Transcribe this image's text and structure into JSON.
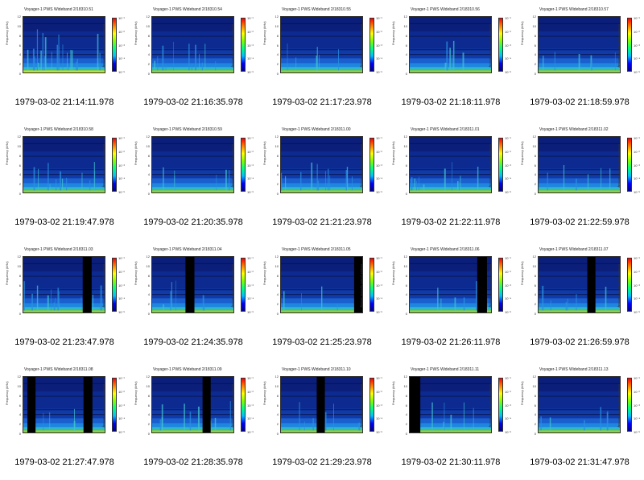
{
  "panels": [
    {
      "title": "Voyager-1 PWS Wideband 2/18310.51",
      "caption": "1979-03-02 21:14:11.978",
      "bursts": "high",
      "gaps": []
    },
    {
      "title": "Voyager-1 PWS Wideband 2/18310.54",
      "caption": "1979-03-02 21:16:35.978",
      "bursts": "med",
      "gaps": []
    },
    {
      "title": "Voyager-1 PWS Wideband 2/18310.55",
      "caption": "1979-03-02 21:17:23.978",
      "bursts": "low",
      "gaps": []
    },
    {
      "title": "Voyager-1 PWS Wideband 2/18310.56",
      "caption": "1979-03-02 21:18:11.978",
      "bursts": "low",
      "gaps": []
    },
    {
      "title": "Voyager-1 PWS Wideband 2/18310.57",
      "caption": "1979-03-02 21:18:59.978",
      "bursts": "low",
      "gaps": []
    },
    {
      "title": "Voyager-1 PWS Wideband 2/18310.58",
      "caption": "1979-03-02 21:19:47.978",
      "bursts": "med",
      "gaps": []
    },
    {
      "title": "Voyager-1 PWS Wideband 2/18310.59",
      "caption": "1979-03-02 21:20:35.978",
      "bursts": "low",
      "gaps": []
    },
    {
      "title": "Voyager-1 PWS Wideband 2/18311.00",
      "caption": "1979-03-02 21:21:23.978",
      "bursts": "med",
      "gaps": []
    },
    {
      "title": "Voyager-1 PWS Wideband 2/18311.01",
      "caption": "1979-03-02 21:22:11.978",
      "bursts": "med",
      "gaps": []
    },
    {
      "title": "Voyager-1 PWS Wideband 2/18311.02",
      "caption": "1979-03-02 21:22:59.978",
      "bursts": "low",
      "gaps": []
    },
    {
      "title": "Voyager-1 PWS Wideband 2/18311.03",
      "caption": "1979-03-02 21:23:47.978",
      "bursts": "med",
      "gaps": [
        [
          0.73,
          0.11
        ]
      ]
    },
    {
      "title": "Voyager-1 PWS Wideband 2/18311.04",
      "caption": "1979-03-02 21:24:35.978",
      "bursts": "low",
      "gaps": [
        [
          0.41,
          0.11
        ]
      ]
    },
    {
      "title": "Voyager-1 PWS Wideband 2/18311.05",
      "caption": "1979-03-02 21:25:23.978",
      "bursts": "low",
      "gaps": [
        [
          0.9,
          0.1
        ]
      ]
    },
    {
      "title": "Voyager-1 PWS Wideband 2/18311.06",
      "caption": "1979-03-02 21:26:11.978",
      "bursts": "low",
      "gaps": [
        [
          0.83,
          0.12
        ]
      ]
    },
    {
      "title": "Voyager-1 PWS Wideband 2/18311.07",
      "caption": "1979-03-02 21:26:59.978",
      "bursts": "low",
      "gaps": [
        [
          0.6,
          0.1
        ]
      ]
    },
    {
      "title": "Voyager-1 PWS Wideband 2/18311.08",
      "caption": "1979-03-02 21:27:47.978",
      "bursts": "low",
      "gaps": [
        [
          0.05,
          0.1
        ],
        [
          0.74,
          0.11
        ]
      ]
    },
    {
      "title": "Voyager-1 PWS Wideband 2/18311.09",
      "caption": "1979-03-02 21:28:35.978",
      "bursts": "med",
      "gaps": [
        [
          0.62,
          0.1
        ]
      ]
    },
    {
      "title": "Voyager-1 PWS Wideband 2/18311.10",
      "caption": "1979-03-02 21:29:23.978",
      "bursts": "low",
      "gaps": [
        [
          0.44,
          0.1
        ]
      ]
    },
    {
      "title": "Voyager-1 PWS Wideband 2/18311.11",
      "caption": "1979-03-02 21:30:11.978",
      "bursts": "low",
      "gaps": [
        [
          0.0,
          0.13
        ]
      ]
    },
    {
      "title": "Voyager-1 PWS Wideband 2/18311.13",
      "caption": "1979-03-02 21:31:47.978",
      "bursts": "low",
      "gaps": []
    }
  ],
  "common": {
    "ylabel": "Frequency (kHz)",
    "yticks": [
      "12",
      "10",
      "8",
      "6",
      "4",
      "2",
      "0"
    ],
    "cbar_label": "relative power spectral density",
    "cbar_ticks": [
      "10⁻¹",
      "10⁻²",
      "10⁻³",
      "10⁻⁴",
      "10⁻⁵"
    ]
  }
}
